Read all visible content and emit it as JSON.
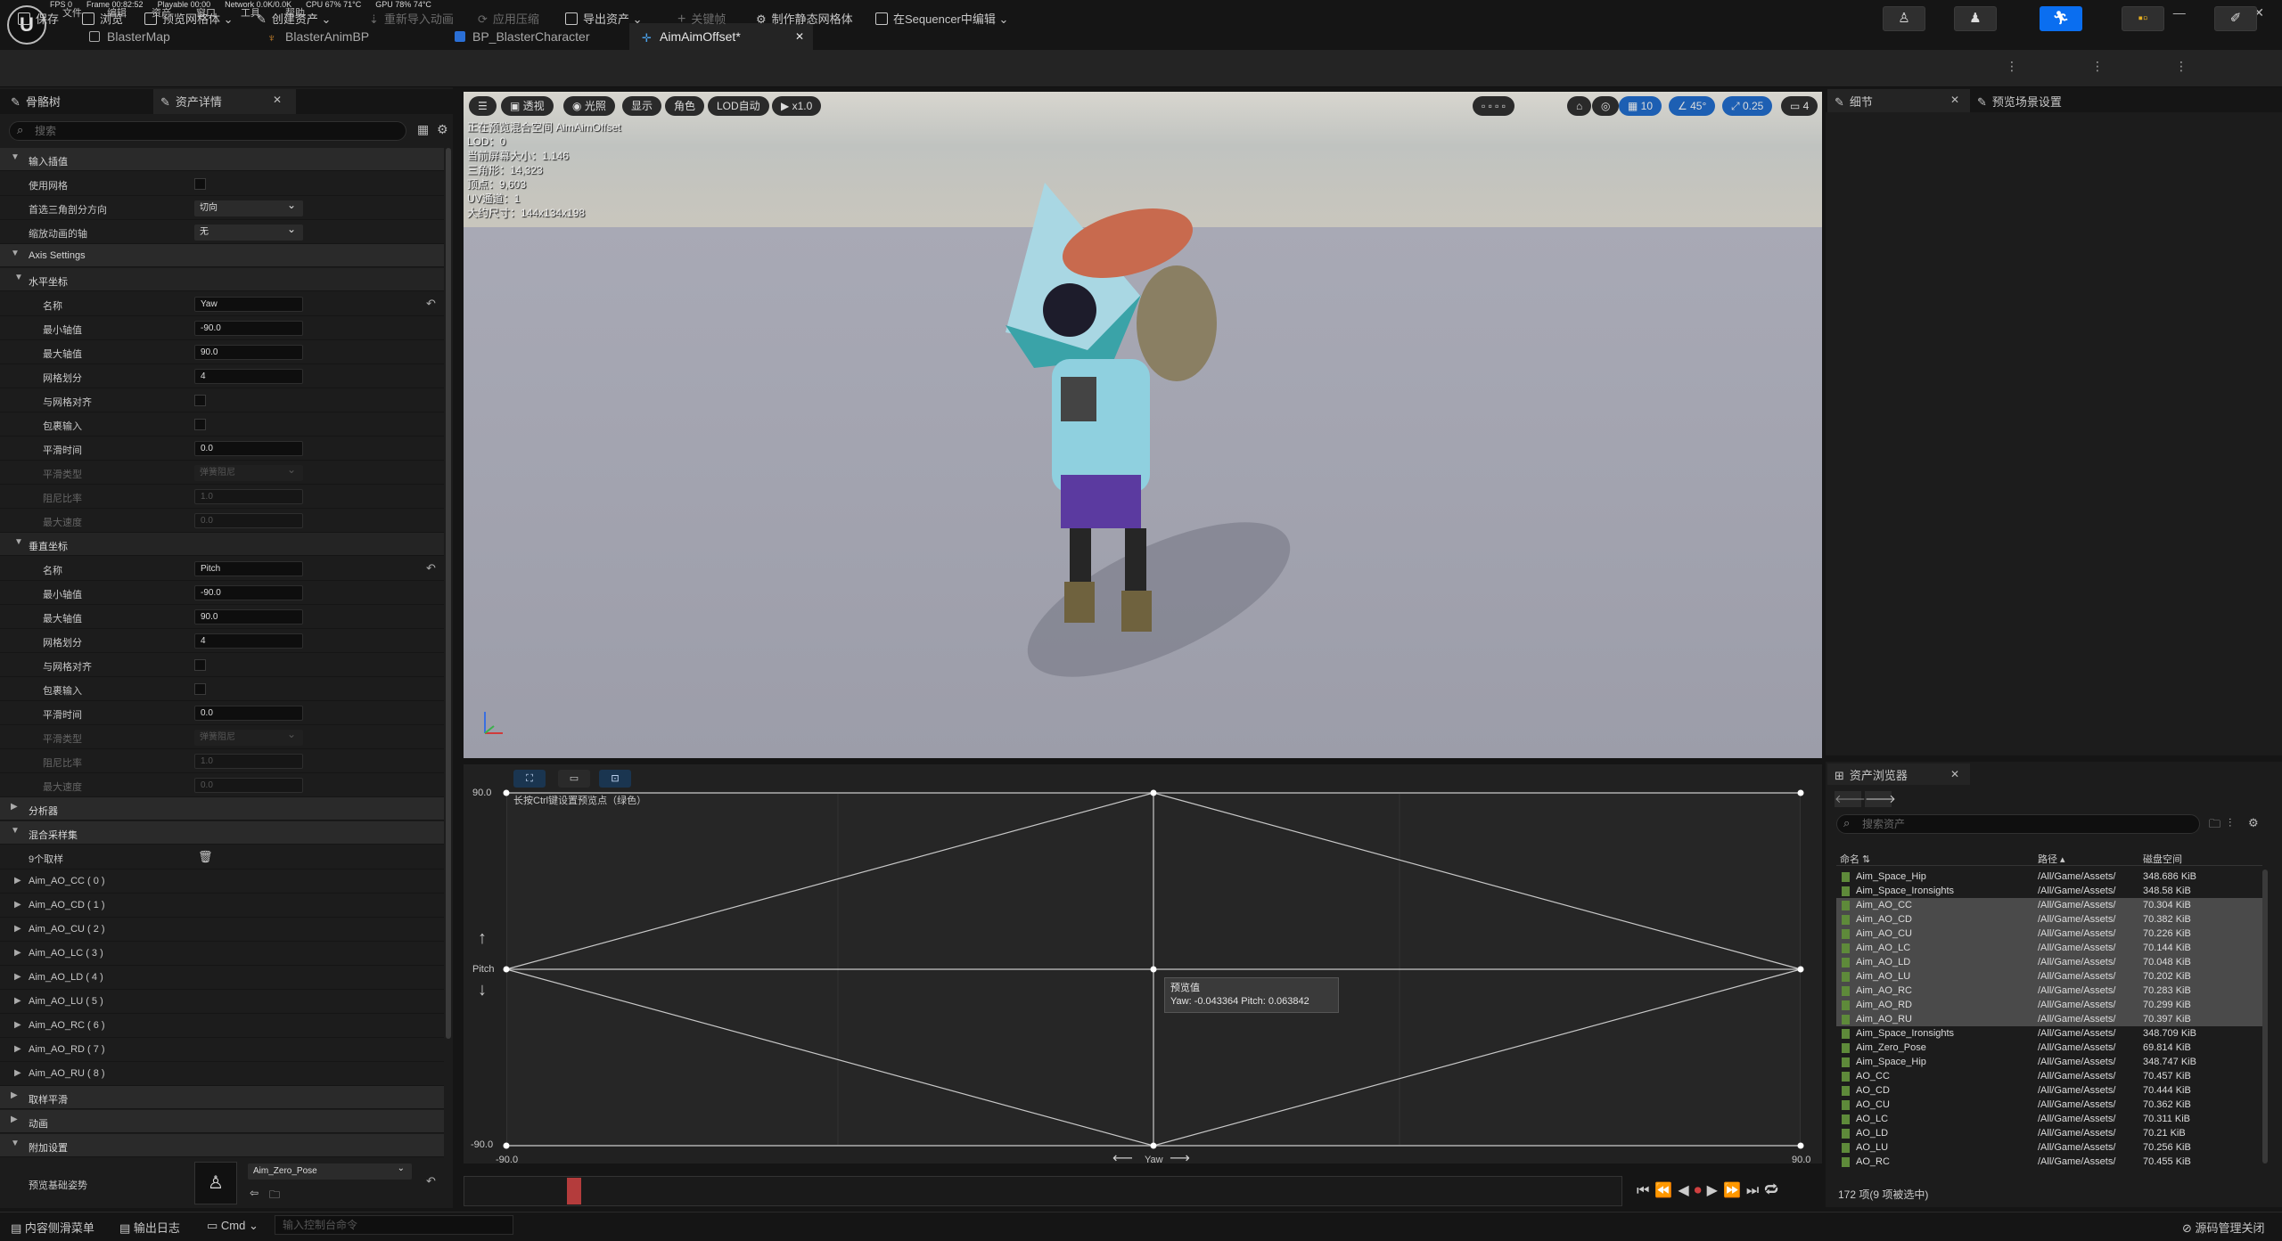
{
  "stats": [
    "FPS 0",
    "Frame 00:82:52",
    "Playable 00:00",
    "Network 0.0K/0.0K",
    "CPU 67% 71°C",
    "GPU 78% 74°C"
  ],
  "menu": [
    "文件",
    "编辑",
    "资产",
    "窗口",
    "工具",
    "帮助"
  ],
  "tabs": [
    {
      "label": "BlasterMap"
    },
    {
      "label": "BlasterAnimBP"
    },
    {
      "label": "BP_BlasterCharacter"
    },
    {
      "label": "AimAimOffset*"
    }
  ],
  "toolbar": {
    "save": "保存",
    "browse": "浏览",
    "preview_mesh": "预览网格体",
    "create_asset": "创建资产",
    "reimport": "重新导入动画",
    "apply_compression": "应用压缩",
    "export_asset": "导出资产",
    "keyframe": "关键帧",
    "make_static_mesh": "制作静态网格体",
    "edit_in_sequencer": "在Sequencer中编辑"
  },
  "left": {
    "tab1": "骨骼树",
    "tab2": "资产详情",
    "search_placeholder": "搜索",
    "sections": {
      "input_interp": "输入插值",
      "axis_settings": "Axis Settings",
      "horizontal": "水平坐标",
      "vertical": "垂直坐标",
      "analysis": "分析器",
      "blend_samples": "混合采样集",
      "sample_smoothing": "取样平滑",
      "animation": "动画",
      "additive": "附加设置"
    },
    "input_rows": [
      {
        "label": "使用网格",
        "type": "chk"
      },
      {
        "label": "首选三角剖分方向",
        "type": "dd",
        "value": "切向"
      },
      {
        "label": "缩放动画的轴",
        "type": "dd",
        "value": "无"
      }
    ],
    "h_rows": [
      {
        "label": "名称",
        "type": "val",
        "value": "Yaw",
        "reset": true
      },
      {
        "label": "最小轴值",
        "type": "val",
        "value": "-90.0"
      },
      {
        "label": "最大轴值",
        "type": "val",
        "value": "90.0"
      },
      {
        "label": "网格划分",
        "type": "val",
        "value": "4"
      },
      {
        "label": "与网格对齐",
        "type": "chk"
      },
      {
        "label": "包裹输入",
        "type": "chk"
      },
      {
        "label": "平滑时间",
        "type": "val",
        "value": "0.0"
      },
      {
        "label": "平滑类型",
        "type": "dd",
        "value": "弹簧阻尼",
        "dim": true
      },
      {
        "label": "阻尼比率",
        "type": "val",
        "value": "1.0",
        "dim": true
      },
      {
        "label": "最大速度",
        "type": "val",
        "value": "0.0",
        "dim": true
      }
    ],
    "v_rows": [
      {
        "label": "名称",
        "type": "val",
        "value": "Pitch",
        "reset": true
      },
      {
        "label": "最小轴值",
        "type": "val",
        "value": "-90.0"
      },
      {
        "label": "最大轴值",
        "type": "val",
        "value": "90.0"
      },
      {
        "label": "网格划分",
        "type": "val",
        "value": "4"
      },
      {
        "label": "与网格对齐",
        "type": "chk"
      },
      {
        "label": "包裹输入",
        "type": "chk"
      },
      {
        "label": "平滑时间",
        "type": "val",
        "value": "0.0"
      },
      {
        "label": "平滑类型",
        "type": "dd",
        "value": "弹簧阻尼",
        "dim": true
      },
      {
        "label": "阻尼比率",
        "type": "val",
        "value": "1.0",
        "dim": true
      },
      {
        "label": "最大速度",
        "type": "val",
        "value": "0.0",
        "dim": true
      }
    ],
    "samples_count": "9个取样",
    "samples": [
      "Aim_AO_CC ( 0 )",
      "Aim_AO_CD ( 1 )",
      "Aim_AO_CU ( 2 )",
      "Aim_AO_LC ( 3 )",
      "Aim_AO_LD ( 4 )",
      "Aim_AO_LU ( 5 )",
      "Aim_AO_RC ( 6 )",
      "Aim_AO_RD ( 7 )",
      "Aim_AO_RU ( 8 )"
    ],
    "base_pose_label": "预览基础姿势",
    "base_pose_value": "Aim_Zero_Pose"
  },
  "viewport": {
    "buttons": [
      "透视",
      "光照",
      "显示",
      "角色",
      "LOD自动",
      "x1.0"
    ],
    "right_values": [
      "10",
      "45°",
      "0.25",
      "4"
    ],
    "info": [
      "正在预览混合空间 AimAimOffset",
      "LOD：0",
      "当前屏幕大小：1.146",
      "三角形：14,323",
      "顶点：9,603",
      "UV通道：1",
      "大约尺寸：144x134x198"
    ]
  },
  "blend": {
    "hint": "长按Ctrl键设置预览点（绿色）",
    "y_max": "90.0",
    "y_min": "-90.0",
    "x_min": "-90.0",
    "x_max": "90.0",
    "y_axis": "Pitch",
    "x_axis": "Yaw",
    "tooltip_title": "预览值",
    "tooltip_value": "Yaw: -0.043364  Pitch: 0.063842"
  },
  "details": {
    "tab1": "细节",
    "tab2": "预览场景设置"
  },
  "browser": {
    "tab": "资产浏览器",
    "search_placeholder": "搜索资产",
    "col_name": "命名",
    "col_path": "路径",
    "col_size": "磁盘空间",
    "rows": [
      {
        "name": "Aim_Space_Hip",
        "path": "/All/Game/Assets/",
        "size": "348.686 KiB",
        "sel": false
      },
      {
        "name": "Aim_Space_Ironsights",
        "path": "/All/Game/Assets/",
        "size": "348.58 KiB",
        "sel": false
      },
      {
        "name": "Aim_AO_CC",
        "path": "/All/Game/Assets/",
        "size": "70.304 KiB",
        "sel": true
      },
      {
        "name": "Aim_AO_CD",
        "path": "/All/Game/Assets/",
        "size": "70.382 KiB",
        "sel": true
      },
      {
        "name": "Aim_AO_CU",
        "path": "/All/Game/Assets/",
        "size": "70.226 KiB",
        "sel": true
      },
      {
        "name": "Aim_AO_LC",
        "path": "/All/Game/Assets/",
        "size": "70.144 KiB",
        "sel": true
      },
      {
        "name": "Aim_AO_LD",
        "path": "/All/Game/Assets/",
        "size": "70.048 KiB",
        "sel": true
      },
      {
        "name": "Aim_AO_LU",
        "path": "/All/Game/Assets/",
        "size": "70.202 KiB",
        "sel": true
      },
      {
        "name": "Aim_AO_RC",
        "path": "/All/Game/Assets/",
        "size": "70.283 KiB",
        "sel": true
      },
      {
        "name": "Aim_AO_RD",
        "path": "/All/Game/Assets/",
        "size": "70.299 KiB",
        "sel": true
      },
      {
        "name": "Aim_AO_RU",
        "path": "/All/Game/Assets/",
        "size": "70.397 KiB",
        "sel": true
      },
      {
        "name": "Aim_Space_Ironsights",
        "path": "/All/Game/Assets/",
        "size": "348.709 KiB",
        "sel": false
      },
      {
        "name": "Aim_Zero_Pose",
        "path": "/All/Game/Assets/",
        "size": "69.814 KiB",
        "sel": false
      },
      {
        "name": "Aim_Space_Hip",
        "path": "/All/Game/Assets/",
        "size": "348.747 KiB",
        "sel": false
      },
      {
        "name": "AO_CC",
        "path": "/All/Game/Assets/",
        "size": "70.457 KiB",
        "sel": false
      },
      {
        "name": "AO_CD",
        "path": "/All/Game/Assets/",
        "size": "70.444 KiB",
        "sel": false
      },
      {
        "name": "AO_CU",
        "path": "/All/Game/Assets/",
        "size": "70.362 KiB",
        "sel": false
      },
      {
        "name": "AO_LC",
        "path": "/All/Game/Assets/",
        "size": "70.311 KiB",
        "sel": false
      },
      {
        "name": "AO_LD",
        "path": "/All/Game/Assets/",
        "size": "70.21 KiB",
        "sel": false
      },
      {
        "name": "AO_LU",
        "path": "/All/Game/Assets/",
        "size": "70.256 KiB",
        "sel": false
      },
      {
        "name": "AO_RC",
        "path": "/All/Game/Assets/",
        "size": "70.455 KiB",
        "sel": false
      }
    ],
    "footer": "172 项(9 项被选中)"
  },
  "status": {
    "content_drawer": "内容侧滑菜单",
    "output_log": "输出日志",
    "cmd": "Cmd",
    "cmd_placeholder": "输入控制台命令",
    "source_control": "源码管理关闭"
  },
  "colors": {
    "accent": "#0a6ef0",
    "selection": "#4a4a4a",
    "anim_icon": "#5e8a3a",
    "scrub": "#b43c3c"
  }
}
